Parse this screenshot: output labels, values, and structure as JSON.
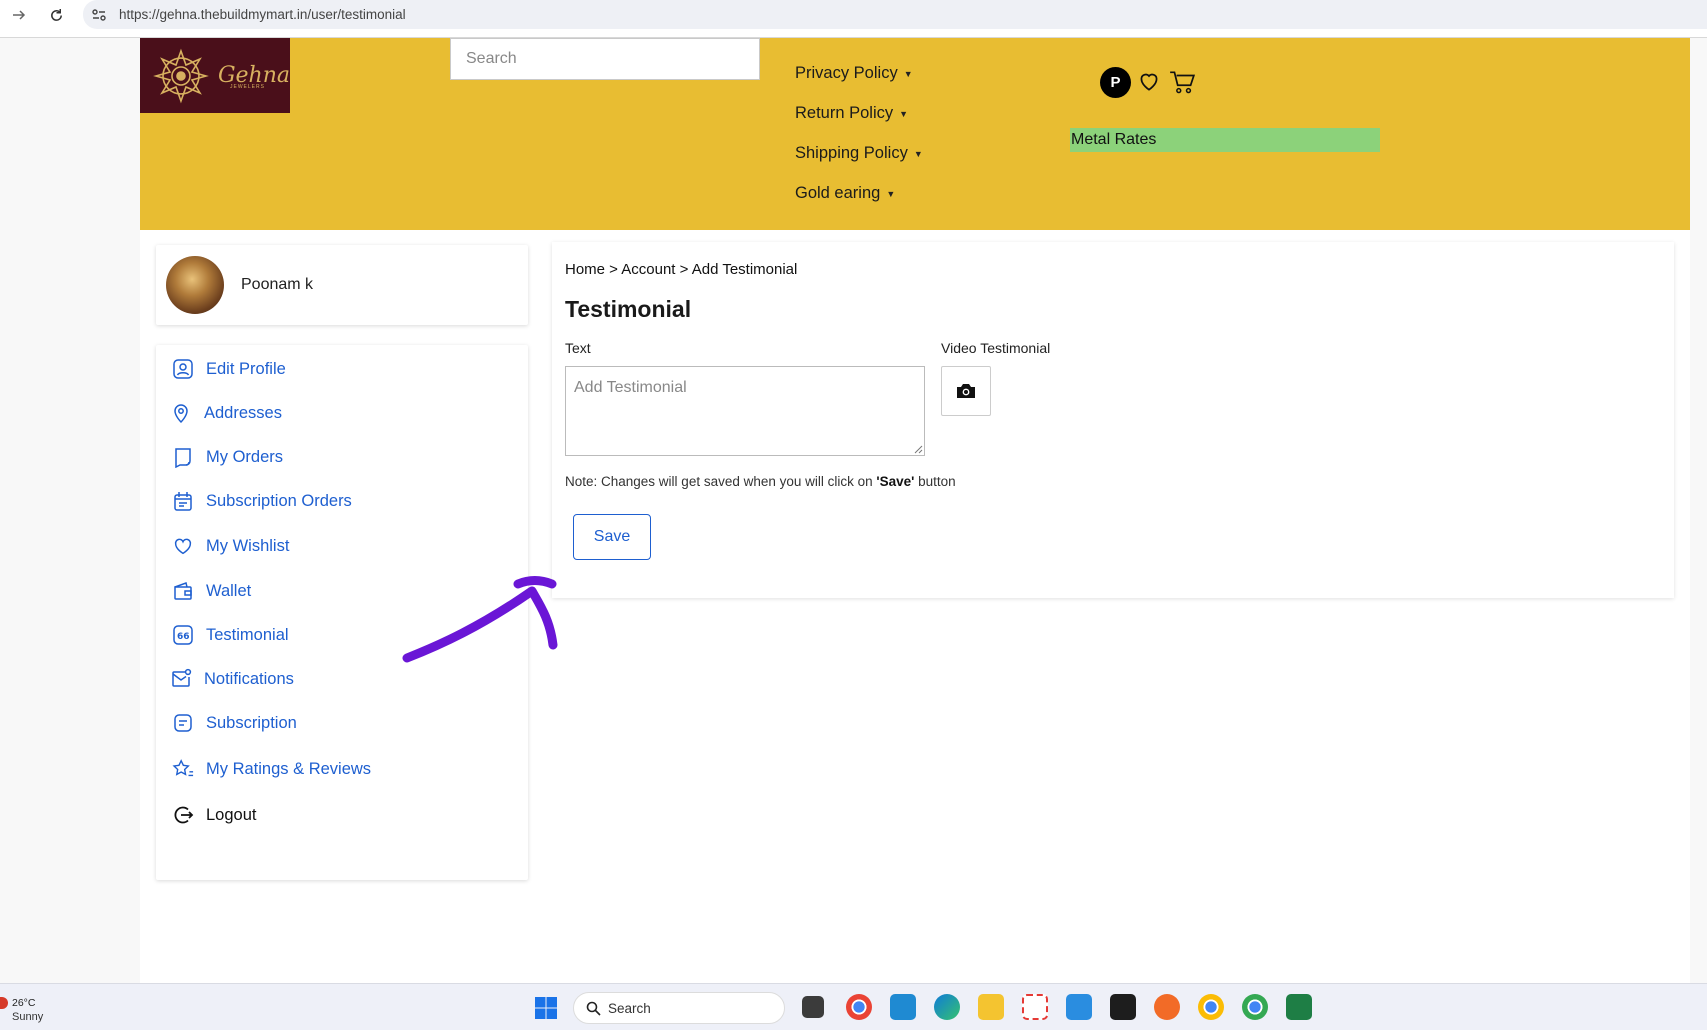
{
  "browser": {
    "url": "https://gehna.thebuildmymart.in/user/testimonial"
  },
  "header": {
    "logo_text": "Gehna",
    "logo_subtext": "JEWELERS",
    "search_placeholder": "Search",
    "menu": [
      {
        "label": "Privacy Policy"
      },
      {
        "label": "Return Policy"
      },
      {
        "label": "Shipping Policy"
      },
      {
        "label": "Gold earing"
      }
    ],
    "user_initial": "P",
    "metal_rates_label": "Metal Rates",
    "colors": {
      "header_bg": "#e8bd32",
      "logo_bg": "#4a0f1a",
      "metal_rates_bg": "#8cd27a"
    }
  },
  "profile": {
    "name": "Poonam k"
  },
  "sidebar": {
    "items": [
      {
        "label": "Edit Profile",
        "icon": "user-icon"
      },
      {
        "label": "Addresses",
        "icon": "location-pin-icon"
      },
      {
        "label": "My Orders",
        "icon": "receipt-icon"
      },
      {
        "label": "Subscription Orders",
        "icon": "calendar-icon"
      },
      {
        "label": "My Wishlist",
        "icon": "heart-icon"
      },
      {
        "label": "Wallet",
        "icon": "wallet-icon"
      },
      {
        "label": "Testimonial",
        "icon": "quote-icon"
      },
      {
        "label": "Notifications",
        "icon": "mail-notification-icon"
      },
      {
        "label": "Subscription",
        "icon": "subscription-icon"
      },
      {
        "label": "My Ratings & Reviews",
        "icon": "star-list-icon"
      },
      {
        "label": "Logout",
        "icon": "logout-icon"
      }
    ]
  },
  "main": {
    "breadcrumb": "Home > Account > Add Testimonial",
    "title": "Testimonial",
    "text_label": "Text",
    "video_label": "Video Testimonial",
    "textarea_placeholder": "Add Testimonial",
    "textarea_value": "",
    "note_prefix": "Note: Changes will get saved when you will click on ",
    "note_bold": "'Save'",
    "note_suffix": " button",
    "save_label": "Save",
    "accent_color": "#1e5fd0"
  },
  "taskbar": {
    "temperature": "26°C",
    "condition": "Sunny",
    "search_label": "Search"
  }
}
